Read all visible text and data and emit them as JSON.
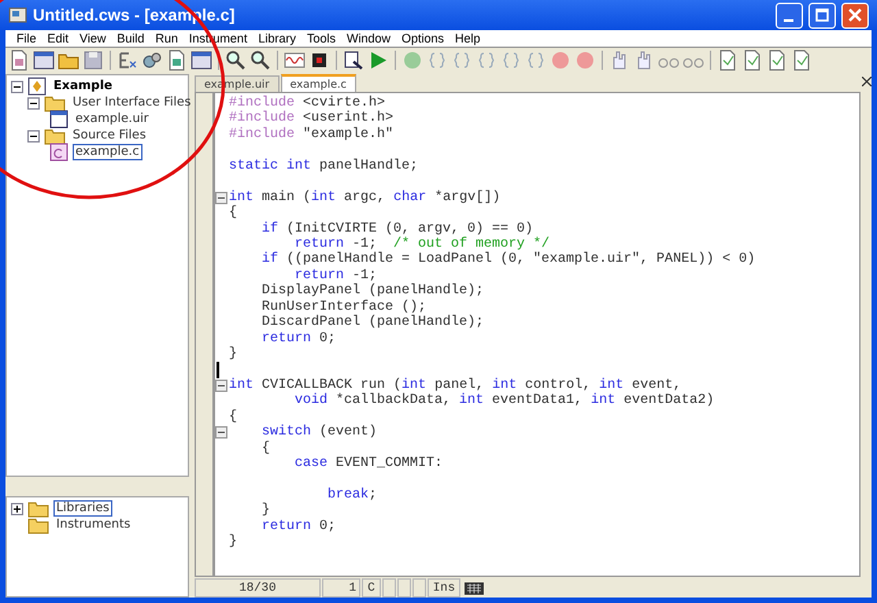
{
  "window": {
    "title": "Untitled.cws - [example.c]"
  },
  "menu": [
    "File",
    "Edit",
    "View",
    "Build",
    "Run",
    "Instrument",
    "Library",
    "Tools",
    "Window",
    "Options",
    "Help"
  ],
  "project_tree": [
    {
      "label": "Example",
      "kind": "project",
      "expanded": true,
      "selected": false,
      "children": [
        {
          "label": "User Interface Files",
          "kind": "folder",
          "expanded": true,
          "selected": false,
          "children": [
            {
              "label": "example.uir",
              "kind": "uir",
              "selected": false
            }
          ]
        },
        {
          "label": "Source Files",
          "kind": "folder",
          "expanded": true,
          "selected": false,
          "children": [
            {
              "label": "example.c",
              "kind": "c",
              "selected": true
            }
          ]
        }
      ]
    }
  ],
  "library_tree": [
    {
      "label": "Libraries",
      "kind": "folder",
      "expanded": false,
      "selected": true
    },
    {
      "label": "Instruments",
      "kind": "folder",
      "selected": false
    }
  ],
  "tabs": [
    {
      "label": "example.uir",
      "selected": false
    },
    {
      "label": "example.c",
      "selected": true
    }
  ],
  "code": [
    {
      "segments": [
        {
          "kind": "preprocessor",
          "t": "#include"
        },
        {
          "kind": "plain",
          "t": " <cvirte.h>"
        }
      ]
    },
    {
      "segments": [
        {
          "kind": "preprocessor",
          "t": "#include"
        },
        {
          "kind": "plain",
          "t": " <userint.h>"
        }
      ]
    },
    {
      "segments": [
        {
          "kind": "preprocessor",
          "t": "#include"
        },
        {
          "kind": "plain",
          "t": " \"example.h\""
        }
      ]
    },
    {
      "space_before": true,
      "segments": [
        {
          "kind": "keyword",
          "t": "static int"
        },
        {
          "kind": "plain",
          "t": " panelHandle;"
        }
      ]
    },
    {
      "space_before": true,
      "fold": true,
      "segments": [
        {
          "kind": "keyword",
          "t": "int"
        },
        {
          "kind": "plain",
          "t": " main ("
        },
        {
          "kind": "keyword",
          "t": "int"
        },
        {
          "kind": "plain",
          "t": " argc, "
        },
        {
          "kind": "keyword",
          "t": "char"
        },
        {
          "kind": "plain",
          "t": " *argv[])"
        }
      ]
    },
    {
      "segments": [
        {
          "kind": "plain",
          "t": "{"
        }
      ]
    },
    {
      "segments": [
        {
          "kind": "keyword",
          "t": "    if"
        },
        {
          "kind": "plain",
          "t": " (InitCVIRTE (0, argv, 0) == 0)"
        }
      ]
    },
    {
      "segments": [
        {
          "kind": "keyword",
          "t": "        return"
        },
        {
          "kind": "plain",
          "t": " -1;  "
        },
        {
          "kind": "comment",
          "t": "/* out of memory */"
        }
      ]
    },
    {
      "segments": [
        {
          "kind": "keyword",
          "t": "    if"
        },
        {
          "kind": "plain",
          "t": " ((panelHandle = LoadPanel (0, \"example.uir\", PANEL)) < 0)"
        }
      ]
    },
    {
      "segments": [
        {
          "kind": "keyword",
          "t": "        return"
        },
        {
          "kind": "plain",
          "t": " -1;"
        }
      ]
    },
    {
      "segments": [
        {
          "kind": "plain",
          "t": "    DisplayPanel (panelHandle);"
        }
      ]
    },
    {
      "segments": [
        {
          "kind": "plain",
          "t": "    RunUserInterface ();"
        }
      ]
    },
    {
      "segments": [
        {
          "kind": "plain",
          "t": "    DiscardPanel (panelHandle);"
        }
      ]
    },
    {
      "segments": [
        {
          "kind": "keyword",
          "t": "    return"
        },
        {
          "kind": "plain",
          "t": " 0;"
        }
      ]
    },
    {
      "segments": [
        {
          "kind": "plain",
          "t": "}"
        }
      ]
    },
    {
      "caret": true
    },
    {
      "fold": true,
      "segments": [
        {
          "kind": "keyword",
          "t": "int"
        },
        {
          "kind": "plain",
          "t": " CVICALLBACK run ("
        },
        {
          "kind": "keyword",
          "t": "int"
        },
        {
          "kind": "plain",
          "t": " panel, "
        },
        {
          "kind": "keyword",
          "t": "int"
        },
        {
          "kind": "plain",
          "t": " control, "
        },
        {
          "kind": "keyword",
          "t": "int"
        },
        {
          "kind": "plain",
          "t": " event,"
        }
      ]
    },
    {
      "segments": [
        {
          "kind": "keyword",
          "t": "        void"
        },
        {
          "kind": "plain",
          "t": " *callbackData, "
        },
        {
          "kind": "keyword",
          "t": "int"
        },
        {
          "kind": "plain",
          "t": " eventData1, "
        },
        {
          "kind": "keyword",
          "t": "int"
        },
        {
          "kind": "plain",
          "t": " eventData2)"
        }
      ]
    },
    {
      "segments": [
        {
          "kind": "plain",
          "t": "{"
        }
      ]
    },
    {
      "fold": true,
      "segments": [
        {
          "kind": "keyword",
          "t": "    switch"
        },
        {
          "kind": "plain",
          "t": " (event)"
        }
      ]
    },
    {
      "segments": [
        {
          "kind": "plain",
          "t": "    {"
        }
      ]
    },
    {
      "segments": [
        {
          "kind": "keyword",
          "t": "        case"
        },
        {
          "kind": "plain",
          "t": " EVENT_COMMIT:"
        }
      ]
    },
    {
      "space_before": true,
      "segments": [
        {
          "kind": "keyword",
          "t": "            break"
        },
        {
          "kind": "plain",
          "t": ";"
        }
      ]
    },
    {
      "segments": [
        {
          "kind": "plain",
          "t": "    }"
        }
      ]
    },
    {
      "segments": [
        {
          "kind": "keyword",
          "t": "    return"
        },
        {
          "kind": "plain",
          "t": " 0;"
        }
      ]
    },
    {
      "segments": [
        {
          "kind": "plain",
          "t": "}"
        }
      ]
    }
  ],
  "status_bar": {
    "position": "18/30",
    "column": "1",
    "language": "C",
    "mode": "Ins"
  }
}
